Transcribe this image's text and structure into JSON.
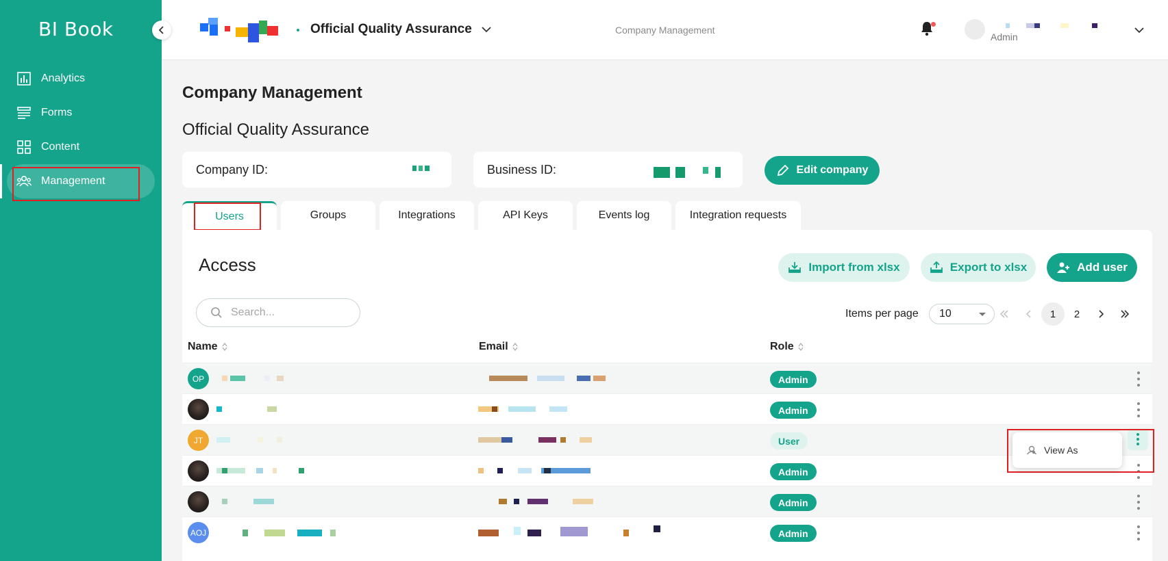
{
  "app": {
    "brand": "BI Book",
    "colors": {
      "primary": "#14a38b",
      "primary_light": "#dff3ee",
      "annotation": "#e02020"
    }
  },
  "sidebar": {
    "items": [
      {
        "label": "Analytics",
        "icon": "analytics-icon"
      },
      {
        "label": "Forms",
        "icon": "forms-icon"
      },
      {
        "label": "Content",
        "icon": "content-icon"
      },
      {
        "label": "Management",
        "icon": "management-icon",
        "active": true
      }
    ]
  },
  "header": {
    "company": "Official Quality Assurance",
    "breadcrumb": "Company Management",
    "user_role": "Admin"
  },
  "page": {
    "title": "Company Management",
    "company_name": "Official Quality Assurance",
    "company_id_label": "Company ID:",
    "business_id_label": "Business ID:",
    "edit_label": "Edit company"
  },
  "tabs": [
    {
      "label": "Users",
      "active": true
    },
    {
      "label": "Groups"
    },
    {
      "label": "Integrations"
    },
    {
      "label": "API Keys"
    },
    {
      "label": "Events log"
    },
    {
      "label": "Integration requests"
    }
  ],
  "access": {
    "title": "Access",
    "import_label": "Import from xlsx",
    "export_label": "Export to xlsx",
    "add_user_label": "Add user",
    "search_placeholder": "Search...",
    "items_per_page_label": "Items per page",
    "items_per_page": "10",
    "pages": [
      "1",
      "2"
    ],
    "current_page": "1"
  },
  "table": {
    "columns": [
      "Name",
      "Email",
      "Role"
    ],
    "rows": [
      {
        "initials": "OP",
        "avatar_color": "#14a38b",
        "role": "Admin"
      },
      {
        "initials": "",
        "photo": true,
        "role": "Admin"
      },
      {
        "initials": "JT",
        "avatar_color": "#f0a830",
        "role": "User",
        "menu_open": true
      },
      {
        "initials": "",
        "photo": true,
        "role": "Admin"
      },
      {
        "initials": "",
        "photo": true,
        "role": "Admin"
      },
      {
        "initials": "AOJ",
        "avatar_color": "#5b8def",
        "role": "Admin"
      }
    ]
  },
  "row_menu": {
    "items": [
      {
        "label": "View As",
        "icon": "view-as-icon"
      }
    ]
  }
}
